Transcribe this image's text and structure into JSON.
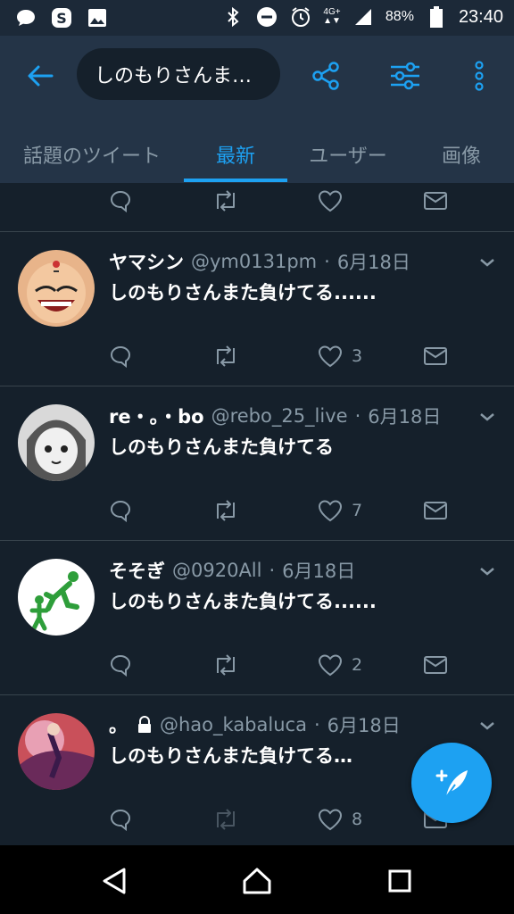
{
  "status_bar": {
    "left_icons": [
      "chat-bubble-icon",
      "skype-icon",
      "image-icon"
    ],
    "right_icons": [
      "bluetooth-icon",
      "do-not-disturb-icon",
      "alarm-icon",
      "signal-icon",
      "battery-icon"
    ],
    "network": "4G+",
    "battery": "88%",
    "time": "23:40"
  },
  "header": {
    "search_query": "しのもりさんま…",
    "icons": [
      "back-arrow-icon",
      "share-icon",
      "filter-sliders-icon",
      "more-vertical-icon"
    ]
  },
  "tabs": [
    {
      "label": "話題のツイート",
      "active": false
    },
    {
      "label": "最新",
      "active": true
    },
    {
      "label": "ユーザー",
      "active": false
    },
    {
      "label": "画像",
      "active": false
    }
  ],
  "tweets": [
    {
      "name": "",
      "handle": "",
      "date": "",
      "text": "",
      "likes": ""
    },
    {
      "name": "ヤマシン",
      "handle": "@ym0131pm",
      "date": "6月18日",
      "text": "しのもりさんまた負けてる......",
      "likes": "3"
    },
    {
      "name": "re・。・bo",
      "handle": "@rebo_25_live",
      "date": "6月18日",
      "text": "しのもりさんまた負けてる",
      "likes": "7"
    },
    {
      "name": "そそぎ",
      "handle": "@0920All",
      "date": "6月18日",
      "text": "しのもりさんまた負けてる......",
      "likes": "2"
    },
    {
      "name": "。",
      "handle": "@hao_kabaluca",
      "date": "6月18日",
      "text": "しのもりさんまた負けてる…",
      "likes": "8",
      "protected": true
    }
  ],
  "colors": {
    "accent": "#1da1f2",
    "background": "#15202b",
    "header": "#243447",
    "muted": "#8899a6"
  }
}
